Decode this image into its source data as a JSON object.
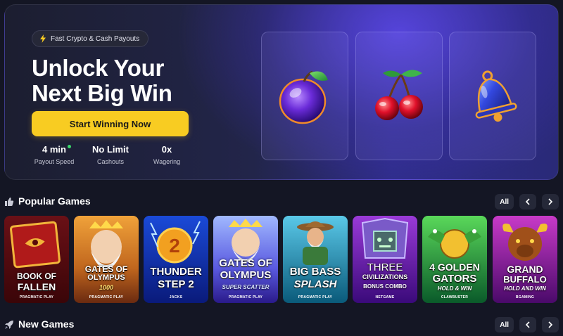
{
  "hero": {
    "badge": "Fast Crypto & Cash Payouts",
    "title_line1": "Unlock Your",
    "title_line2": "Next Big Win",
    "cta": "Start Winning Now",
    "stats": [
      {
        "value": "4 min",
        "label": "Payout Speed"
      },
      {
        "value": "No Limit",
        "label": "Cashouts"
      },
      {
        "value": "0x",
        "label": "Wagering"
      }
    ],
    "slot_symbols": [
      "plum-icon",
      "cherry-icon",
      "bell-icon"
    ],
    "accent_color": "#f8cc22",
    "status_dot_color": "#39d96b"
  },
  "popular": {
    "title": "Popular Games",
    "icon": "thumbs-up-icon",
    "all_label": "All",
    "prev_icon": "chevron-left-icon",
    "next_icon": "chevron-right-icon",
    "games": [
      {
        "line1": "BOOK OF",
        "line2": "FALLEN",
        "provider": "PRAGMATIC PLAY"
      },
      {
        "line1": "GATES OF",
        "line2": "OLYMPUS",
        "sub": "1000",
        "provider": "PRAGMATIC PLAY"
      },
      {
        "line1": "THUNDER",
        "line2": "STEP 2",
        "provider": "JACKS"
      },
      {
        "line1": "GATES OF",
        "line2": "OLYMPUS",
        "sub": "SUPER SCATTER",
        "provider": "PRAGMATIC PLAY"
      },
      {
        "line1": "BIG BASS",
        "line2": "SPLASH",
        "provider": "PRAGMATIC PLAY"
      },
      {
        "line1": "THREE",
        "line2": "CIVILIZATIONS",
        "sub": "BONUS COMBO",
        "provider": "NETGAME"
      },
      {
        "line1": "4 GOLDEN",
        "line2": "GATORS",
        "sub": "HOLD & WIN",
        "provider": "CLAWBUSTER"
      },
      {
        "line1": "GRAND",
        "line2": "BUFFALO",
        "sub": "HOLD AND WIN",
        "provider": "BGAMING"
      }
    ]
  },
  "new_games": {
    "title": "New Games",
    "icon": "rocket-icon",
    "all_label": "All",
    "prev_icon": "chevron-left-icon",
    "next_icon": "chevron-right-icon"
  }
}
